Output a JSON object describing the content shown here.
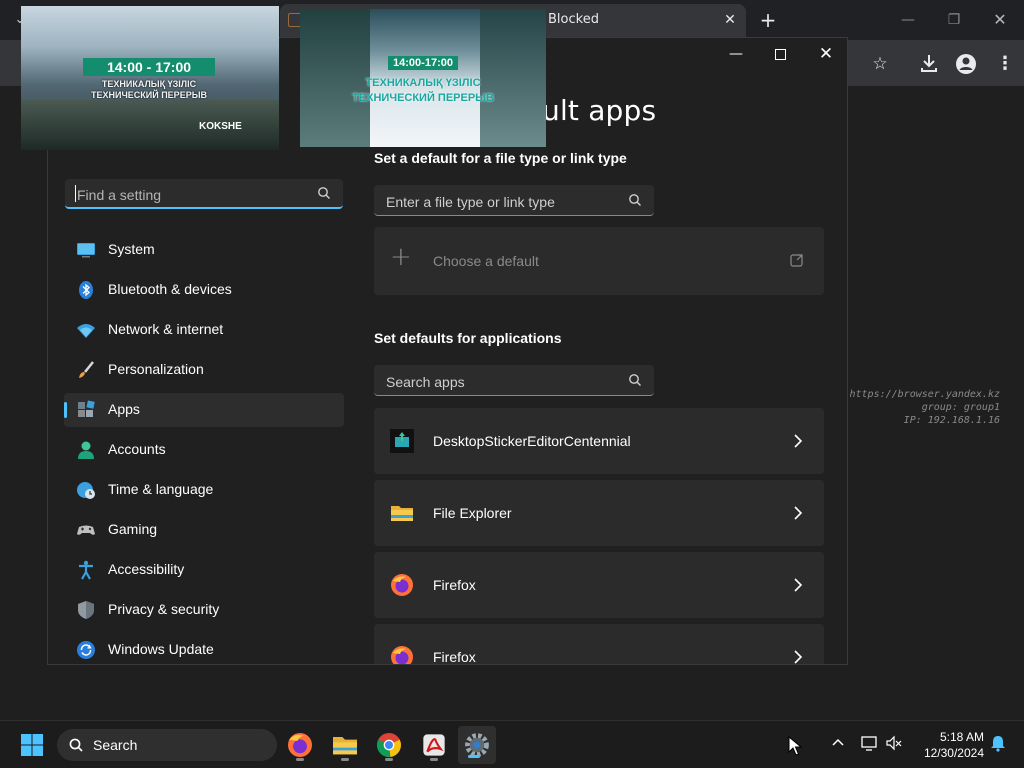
{
  "browser": {
    "tab_title": "Blocked",
    "new_tab_label": "+",
    "watermark": {
      "line1": "https://browser.yandex.kz",
      "line2": "group: group1",
      "line3": "IP: 192.168.1.16"
    }
  },
  "settings": {
    "page_title": "ult apps",
    "find_placeholder": "Find a setting",
    "nav": [
      {
        "label": "System",
        "icon": "system-icon"
      },
      {
        "label": "Bluetooth & devices",
        "icon": "bluetooth-icon"
      },
      {
        "label": "Network & internet",
        "icon": "wifi-icon"
      },
      {
        "label": "Personalization",
        "icon": "brush-icon"
      },
      {
        "label": "Apps",
        "icon": "apps-icon",
        "active": true
      },
      {
        "label": "Accounts",
        "icon": "person-icon"
      },
      {
        "label": "Time & language",
        "icon": "clock-globe-icon"
      },
      {
        "label": "Gaming",
        "icon": "gamepad-icon"
      },
      {
        "label": "Accessibility",
        "icon": "accessibility-icon"
      },
      {
        "label": "Privacy & security",
        "icon": "shield-icon"
      },
      {
        "label": "Windows Update",
        "icon": "update-icon"
      }
    ],
    "filetype_heading": "Set a default for a file type or link type",
    "filetype_placeholder": "Enter a file type or link type",
    "choose_default_label": "Choose a default",
    "apps_heading": "Set defaults for applications",
    "apps_placeholder": "Search apps",
    "apps": [
      {
        "name": "DesktopStickerEditorCentennial",
        "icon": "sticker-editor-icon"
      },
      {
        "name": "File Explorer",
        "icon": "folder-icon"
      },
      {
        "name": "Firefox",
        "icon": "firefox-icon"
      },
      {
        "name": "Firefox",
        "icon": "firefox-icon"
      }
    ]
  },
  "overlay": {
    "thumb1": {
      "time": "14:00 - 17:00",
      "line1": "ТЕХНИКАЛЫҚ ҮЗІЛІС",
      "line2": "ТЕХНИЧЕСКИЙ ПЕРЕРЫВ",
      "brand": "KOKSHE"
    },
    "thumb2": {
      "time": "14:00-17:00",
      "line1": "ТЕХНИКАЛЫҚ ҮЗІЛІС",
      "line2": "ТЕХНИЧЕСКИЙ ПЕРЕРЫВ"
    }
  },
  "taskbar": {
    "search_label": "Search",
    "time": "5:18 AM",
    "date": "12/30/2024"
  },
  "colors": {
    "accent": "#4cc2ff",
    "banner": "#148c6e"
  }
}
